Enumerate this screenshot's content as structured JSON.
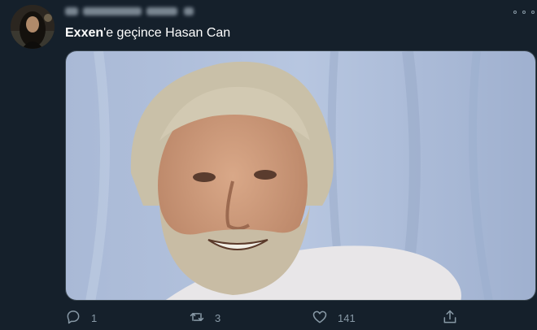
{
  "tweet": {
    "text_bold": "Exxen",
    "text_rest": "'e geçince Hasan Can"
  },
  "actions": {
    "reply_count": "1",
    "retweet_count": "3",
    "like_count": "141"
  },
  "icons": {
    "more": "more-horizontal-icon",
    "reply": "reply-icon",
    "retweet": "retweet-icon",
    "like": "heart-icon",
    "share": "share-icon"
  },
  "colors": {
    "background": "#15202b",
    "text": "#ffffff",
    "secondary": "#8899a6"
  }
}
